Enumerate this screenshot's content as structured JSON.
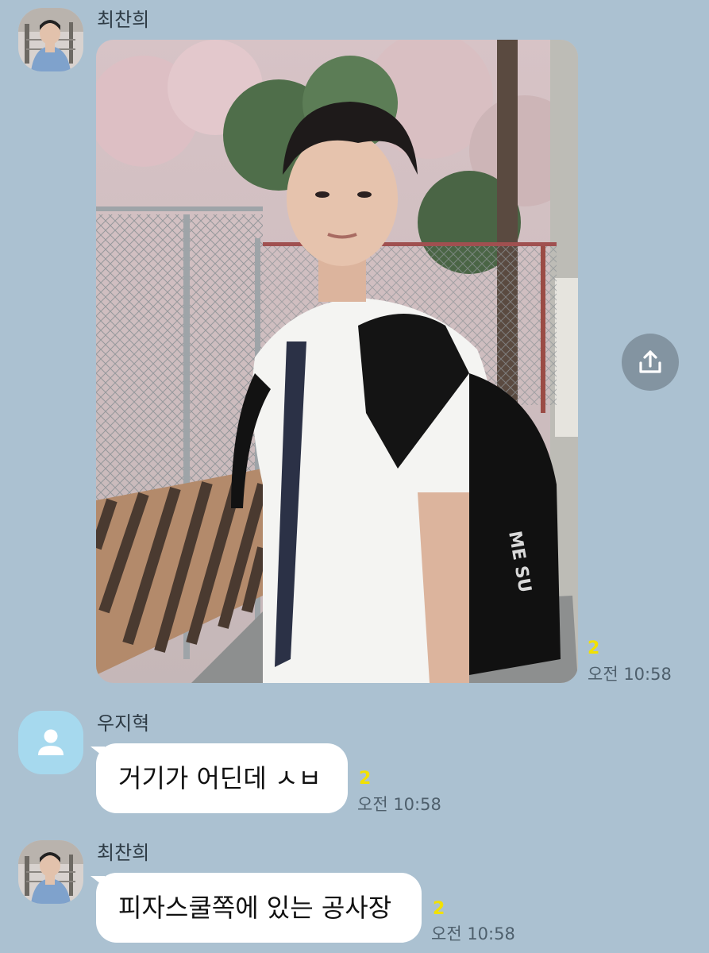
{
  "messages": [
    {
      "sender": "최찬희",
      "type": "photo",
      "unread": "2",
      "time": "오전 10:58"
    },
    {
      "sender": "우지혁",
      "type": "text",
      "text": "거기가 어딘데 ㅅㅂ",
      "unread": "2",
      "time": "오전 10:58"
    },
    {
      "sender": "최찬희",
      "type": "text",
      "text": "피자스쿨쪽에 있는 공사장",
      "unread": "2",
      "time": "오전 10:58"
    }
  ],
  "icons": {
    "share": "share-icon",
    "default_profile": "person-icon"
  },
  "colors": {
    "chat_background": "#abc1d1",
    "bubble": "#ffffff",
    "unread": "#f2e100",
    "share_button": "#8394a1",
    "default_avatar": "#a6d9ee"
  }
}
